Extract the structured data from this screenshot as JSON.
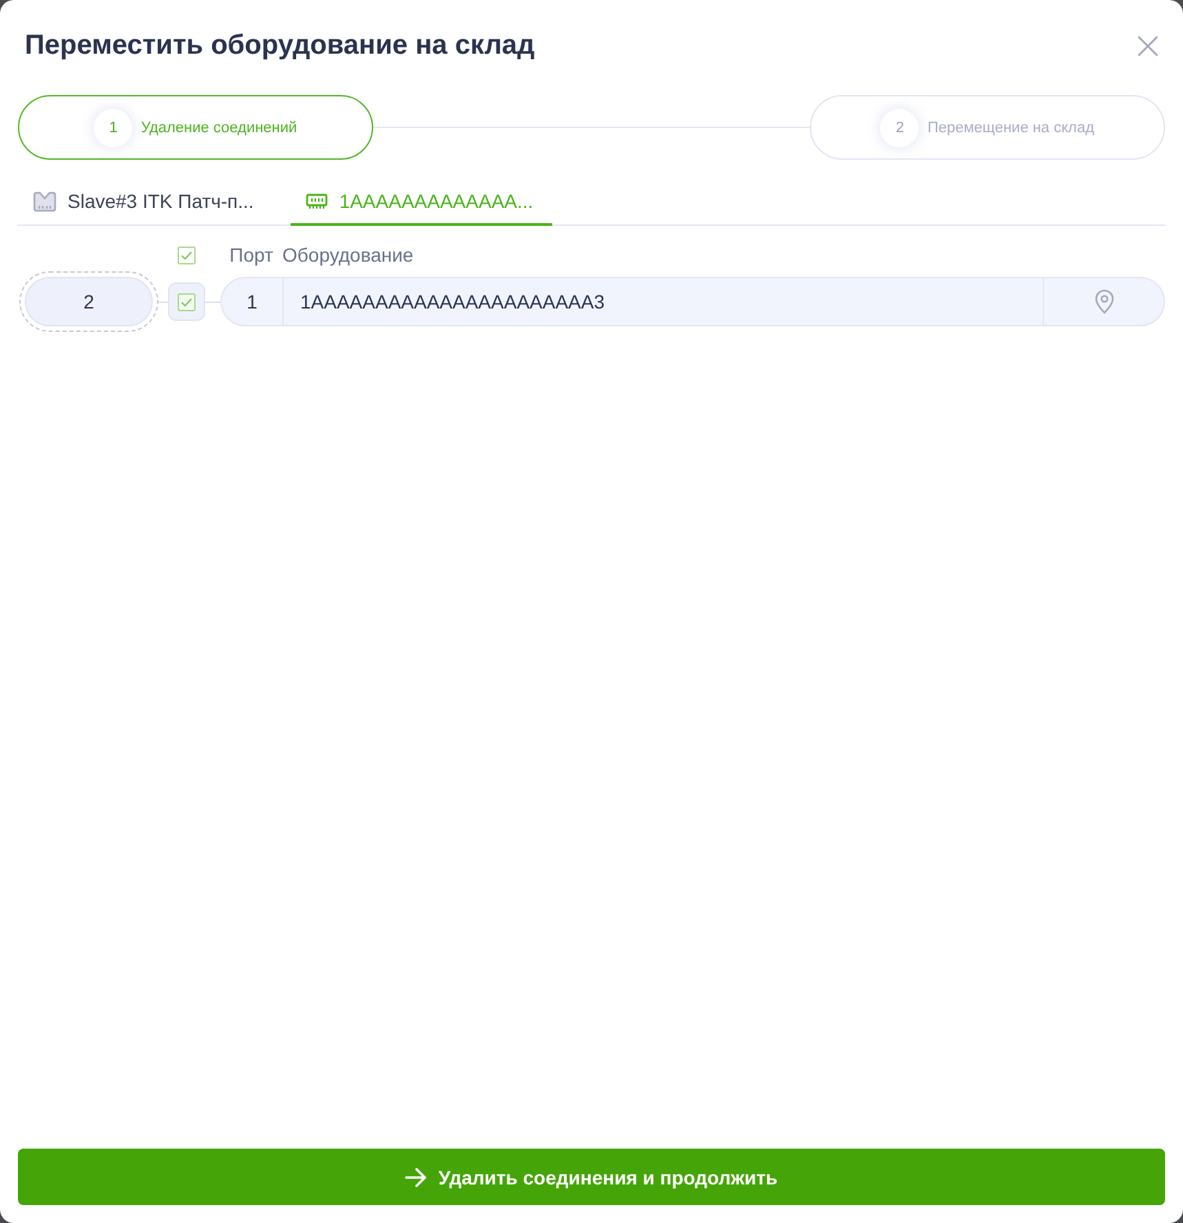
{
  "window": {
    "title": "Переместить оборудование на склад"
  },
  "steps": [
    {
      "number": "1",
      "label": "Удаление соединений",
      "selected": true
    },
    {
      "number": "2",
      "label": "Перемещение на склад",
      "selected": false
    }
  ],
  "tabs": [
    {
      "kind": "patch_panel",
      "label": "Slave#3 ITK Патч-п...",
      "selected": false
    },
    {
      "kind": "module",
      "label": "1AAAAAAAAAAAAA...",
      "selected": true
    }
  ],
  "table": {
    "all_checked": true,
    "columns": [
      "Порт",
      "Оборудование"
    ],
    "rows": [
      {
        "group": "2",
        "checked": true,
        "port": "1",
        "equipment": "1AAAAAAAAAAAAAAAAAAAAAA3"
      }
    ]
  },
  "primary_button": {
    "label": "Удалить соединения и продолжить"
  }
}
